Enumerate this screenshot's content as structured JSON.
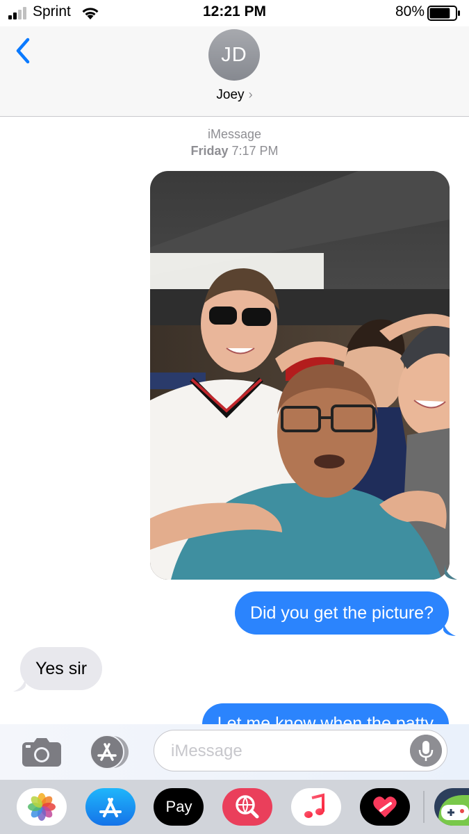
{
  "status_bar": {
    "carrier": "Sprint",
    "time": "12:21 PM",
    "battery_percent": "80%",
    "battery_level": 0.8,
    "signal_bars": 2,
    "icons": [
      "signal-icon",
      "wifi-icon",
      "battery-icon"
    ]
  },
  "header": {
    "avatar_initials": "JD",
    "contact_name": "Joey",
    "chevron": "›",
    "icons": [
      "back-chevron-icon",
      "chevron-right-icon"
    ]
  },
  "conversation": {
    "service_label": "iMessage",
    "day": "Friday",
    "time": "7:17 PM",
    "messages": [
      {
        "direction": "outgoing",
        "type": "photo"
      },
      {
        "direction": "outgoing",
        "type": "text",
        "text": "Did you get the picture?"
      },
      {
        "direction": "incoming",
        "type": "text",
        "text": "Yes sir"
      },
      {
        "direction": "outgoing",
        "type": "text",
        "text": "Let me know when the patty"
      }
    ]
  },
  "input_bar": {
    "placeholder": "iMessage",
    "value": "",
    "icons": [
      "camera-icon",
      "app-store-icon",
      "microphone-icon"
    ]
  },
  "app_drawer": {
    "apps": [
      {
        "name": "Photos",
        "icon": "photos-icon"
      },
      {
        "name": "App Store",
        "icon": "app-store-icon"
      },
      {
        "name": "Apple Pay",
        "icon": "apple-pay-icon",
        "label": "Pay",
        "logo_glyph": ""
      },
      {
        "name": "Search",
        "icon": "web-search-icon"
      },
      {
        "name": "Music",
        "icon": "music-note-icon"
      },
      {
        "name": "Digital Touch",
        "icon": "digital-touch-heart-icon"
      },
      {
        "name": "Game",
        "icon": "game-app-icon"
      }
    ]
  },
  "colors": {
    "imessage_blue": "#2b84fd",
    "incoming_gray": "#e8e8ed",
    "ios_blue": "#0a7aff",
    "meta_gray": "#8e8e93"
  }
}
